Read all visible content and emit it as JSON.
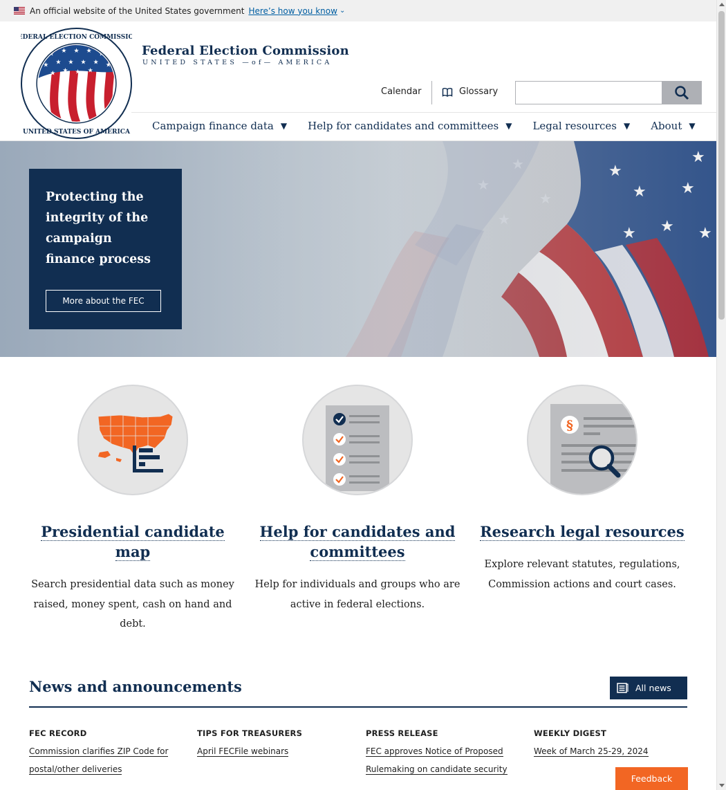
{
  "gov_banner": {
    "text": "An official website of the United States government",
    "link": "Here’s how you know"
  },
  "header": {
    "seal_text_top": "FEDERAL ELECTION COMMISSION",
    "seal_text_bottom": "UNITED STATES OF AMERICA",
    "title": "Federal Election Commission",
    "subtitle": "UNITED STATES —of— AMERICA",
    "calendar": "Calendar",
    "glossary": "Glossary",
    "search_placeholder": "",
    "nav": [
      {
        "label": "Campaign finance data"
      },
      {
        "label": "Help for candidates and committees"
      },
      {
        "label": "Legal resources"
      },
      {
        "label": "About"
      }
    ]
  },
  "hero": {
    "title": "Protecting the integrity of the campaign finance process",
    "button": "More about the FEC"
  },
  "features": [
    {
      "title": "Presidential candidate map",
      "text": "Search presidential data such as money raised, money spent, cash on hand and debt.",
      "icon": "us-map-icon"
    },
    {
      "title": "Help for candidates and committees",
      "text": "Help for individuals and groups who are active in federal elections.",
      "icon": "checklist-icon"
    },
    {
      "title": "Research legal resources",
      "text": "Explore relevant statutes, regulations, Commission actions and court cases.",
      "icon": "legal-search-icon"
    }
  ],
  "news": {
    "title": "News and announcements",
    "all_news": "All news",
    "items": [
      {
        "category": "FEC RECORD",
        "link": "Commission clarifies ZIP Code for postal/other deliveries"
      },
      {
        "category": "TIPS FOR TREASURERS",
        "link": "April FECFile webinars"
      },
      {
        "category": "PRESS RELEASE",
        "link": "FEC approves Notice of Proposed Rulemaking on candidate security"
      },
      {
        "category": "WEEKLY DIGEST",
        "link": "Week of March 25-29, 2024"
      }
    ]
  },
  "feedback": "Feedback",
  "colors": {
    "navy": "#112e51",
    "orange": "#f26623",
    "gray": "#e5e5e5",
    "link_blue": "#005ea2"
  }
}
